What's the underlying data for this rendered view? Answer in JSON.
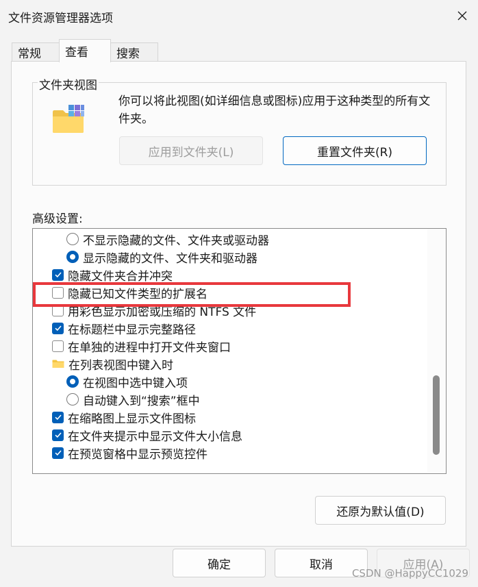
{
  "window": {
    "title": "文件资源管理器选项"
  },
  "tabs": [
    {
      "label": "常规",
      "active": false
    },
    {
      "label": "查看",
      "active": true
    },
    {
      "label": "搜索",
      "active": false
    }
  ],
  "folder_views": {
    "group_label": "文件夹视图",
    "description": "你可以将此视图(如详细信息或图标)应用于这种类型的所有文件夹。",
    "apply_button": "应用到文件夹(L)",
    "reset_button": "重置文件夹(R)"
  },
  "advanced": {
    "label": "高级设置:",
    "items": [
      {
        "type": "radio",
        "checked": false,
        "indent": 1,
        "label": "不显示隐藏的文件、文件夹或驱动器"
      },
      {
        "type": "radio",
        "checked": true,
        "indent": 1,
        "label": "显示隐藏的文件、文件夹和驱动器"
      },
      {
        "type": "checkbox",
        "checked": true,
        "indent": 0,
        "label": "隐藏文件夹合并冲突"
      },
      {
        "type": "checkbox",
        "checked": false,
        "indent": 0,
        "label": "隐藏已知文件类型的扩展名"
      },
      {
        "type": "checkbox",
        "checked": false,
        "indent": 0,
        "label": "用彩色显示加密或压缩的 NTFS 文件"
      },
      {
        "type": "checkbox",
        "checked": true,
        "indent": 0,
        "label": "在标题栏中显示完整路径"
      },
      {
        "type": "checkbox",
        "checked": false,
        "indent": 0,
        "label": "在单独的进程中打开文件夹窗口"
      },
      {
        "type": "folder",
        "indent": 0,
        "label": "在列表视图中键入时"
      },
      {
        "type": "radio",
        "checked": true,
        "indent": 1,
        "label": "在视图中选中键入项"
      },
      {
        "type": "radio",
        "checked": false,
        "indent": 1,
        "label": "自动键入到“搜索”框中"
      },
      {
        "type": "checkbox",
        "checked": true,
        "indent": 0,
        "label": "在缩略图上显示文件图标"
      },
      {
        "type": "checkbox",
        "checked": true,
        "indent": 0,
        "label": "在文件夹提示中显示文件大小信息"
      },
      {
        "type": "checkbox",
        "checked": true,
        "indent": 0,
        "label": "在预览窗格中显示预览控件"
      }
    ],
    "restore_button": "还原为默认值(D)"
  },
  "footer": {
    "ok": "确定",
    "cancel": "取消",
    "apply": "应用(A)"
  },
  "watermark": "CSDN @HappyCC1029",
  "colors": {
    "accent": "#005fb8",
    "highlight": "#e8383d"
  }
}
